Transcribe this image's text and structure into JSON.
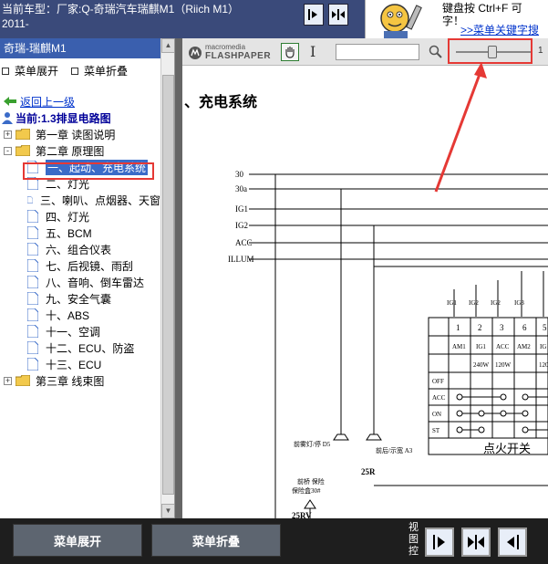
{
  "header": {
    "title_line1": "当前车型：厂家:Q-奇瑞汽车瑞麒M1（Riich M1）",
    "title_line2": "2011-",
    "ad_line1": "键盘按 Ctrl+F 可",
    "ad_line2": "字！",
    "ad_link": ">>菜单关键字搜",
    "nav_icons": [
      "arrow-right-bar-icon",
      "arrows-inward-icon"
    ]
  },
  "sidebar": {
    "header": "奇瑞-瑞麒M1",
    "expand_label": "菜单展开",
    "collapse_label": "菜单折叠",
    "back_label": "返回上一级",
    "current_label": "当前:1.3排显电路图",
    "chapters": [
      {
        "label": "第一章 读图说明",
        "expander": "+"
      },
      {
        "label": "第二章 原理图",
        "expander": "-"
      }
    ],
    "items": [
      "一、起动、充电系统",
      "二、灯光",
      "三、喇叭、点烟器、天窗",
      "四、灯光",
      "五、BCM",
      "六、组合仪表",
      "七、后视镜、雨刮",
      "八、音响、倒车雷达",
      "九、安全气囊",
      "十、ABS",
      "十一、空调",
      "十二、ECU、防盗",
      "十三、ECU"
    ],
    "chapter3": {
      "label": "第三章 线束图",
      "expander": "+"
    }
  },
  "viewer": {
    "logo_top": "macromedia",
    "logo_bottom": "FLASHPAPER",
    "text_tool": "I",
    "search_value": "",
    "zoom_label": "1",
    "zoom_fraction": 0.5,
    "page_title": "、充电系统",
    "schematic": {
      "rails": [
        "30",
        "30a",
        "IG1",
        "IG2",
        "ACC",
        "ILLUM"
      ],
      "fuse_labels": [
        "IG1",
        "IG2",
        "IG2",
        "IG3"
      ],
      "col_headers": [
        "1",
        "2",
        "3",
        "6",
        "5"
      ],
      "row2": [
        "AM1",
        "IG1",
        "ACC",
        "AM2",
        "IG"
      ],
      "row3": [
        "",
        "240W",
        "120W",
        "",
        "120"
      ],
      "states": [
        "OFF",
        "ACC",
        "ON",
        "ST"
      ],
      "switch_caption": "点火开关",
      "label_left_mid": "前雾灯/停 D5",
      "label_right_mid": "前后/示宽 A3",
      "label_25r": "25R",
      "label_25rv": "25RV",
      "label_bottom_left": "前桥 保险",
      "label_bottom_left2": "保险盒30#"
    }
  },
  "footer": {
    "expand_label": "菜单展开",
    "collapse_label": "菜单折叠",
    "view_label": "视图控",
    "view_icons": [
      "next-page-icon",
      "fit-width-icon",
      "prev-page-icon"
    ]
  }
}
